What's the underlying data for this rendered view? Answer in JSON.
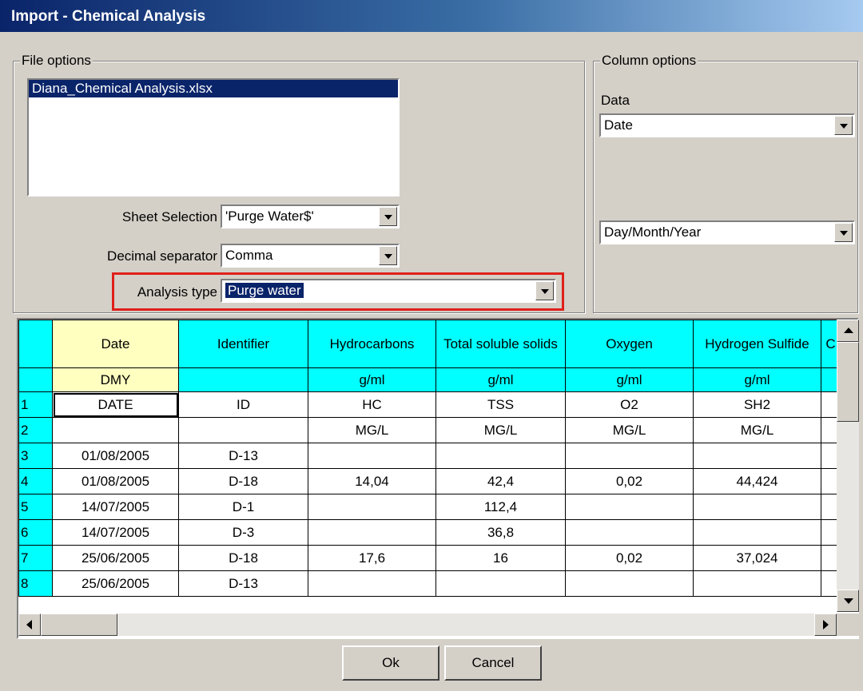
{
  "window": {
    "title": "Import - Chemical Analysis"
  },
  "file_options": {
    "legend": "File options",
    "files": [
      "Diana_Chemical Analysis.xlsx"
    ],
    "sheet_selection": {
      "label": "Sheet Selection",
      "value": "'Purge Water$'"
    },
    "decimal_separator": {
      "label": "Decimal separator",
      "value": "Comma"
    },
    "analysis_type": {
      "label": "Analysis type",
      "value": "Purge water"
    }
  },
  "column_options": {
    "legend": "Column options",
    "data_label": "Data",
    "data_value": "Date",
    "format_value": "Day/Month/Year"
  },
  "grid": {
    "headers": [
      "Date",
      "Identifier",
      "Hydrocarbons",
      "Total soluble solids",
      "Oxygen",
      "Hydrogen Sulfide",
      "C"
    ],
    "units": [
      "DMY",
      "",
      "g/ml",
      "g/ml",
      "g/ml",
      "g/ml",
      ""
    ],
    "rows": [
      {
        "num": "1",
        "cells": [
          "DATE",
          "ID",
          "HC",
          "TSS",
          "O2",
          "SH2",
          ""
        ]
      },
      {
        "num": "2",
        "cells": [
          "",
          "",
          "MG/L",
          "MG/L",
          "MG/L",
          "MG/L",
          ""
        ]
      },
      {
        "num": "3",
        "cells": [
          "01/08/2005",
          "D-13",
          "",
          "",
          "",
          "",
          ""
        ]
      },
      {
        "num": "4",
        "cells": [
          "01/08/2005",
          "D-18",
          "14,04",
          "42,4",
          "0,02",
          "44,424",
          ""
        ]
      },
      {
        "num": "5",
        "cells": [
          "14/07/2005",
          "D-1",
          "",
          "112,4",
          "",
          "",
          ""
        ]
      },
      {
        "num": "6",
        "cells": [
          "14/07/2005",
          "D-3",
          "",
          "36,8",
          "",
          "",
          ""
        ]
      },
      {
        "num": "7",
        "cells": [
          "25/06/2005",
          "D-18",
          "17,6",
          "16",
          "0,02",
          "37,024",
          ""
        ]
      },
      {
        "num": "8",
        "cells": [
          "25/06/2005",
          "D-13",
          "",
          "",
          "",
          "",
          ""
        ]
      }
    ]
  },
  "buttons": {
    "ok": "Ok",
    "cancel": "Cancel"
  }
}
